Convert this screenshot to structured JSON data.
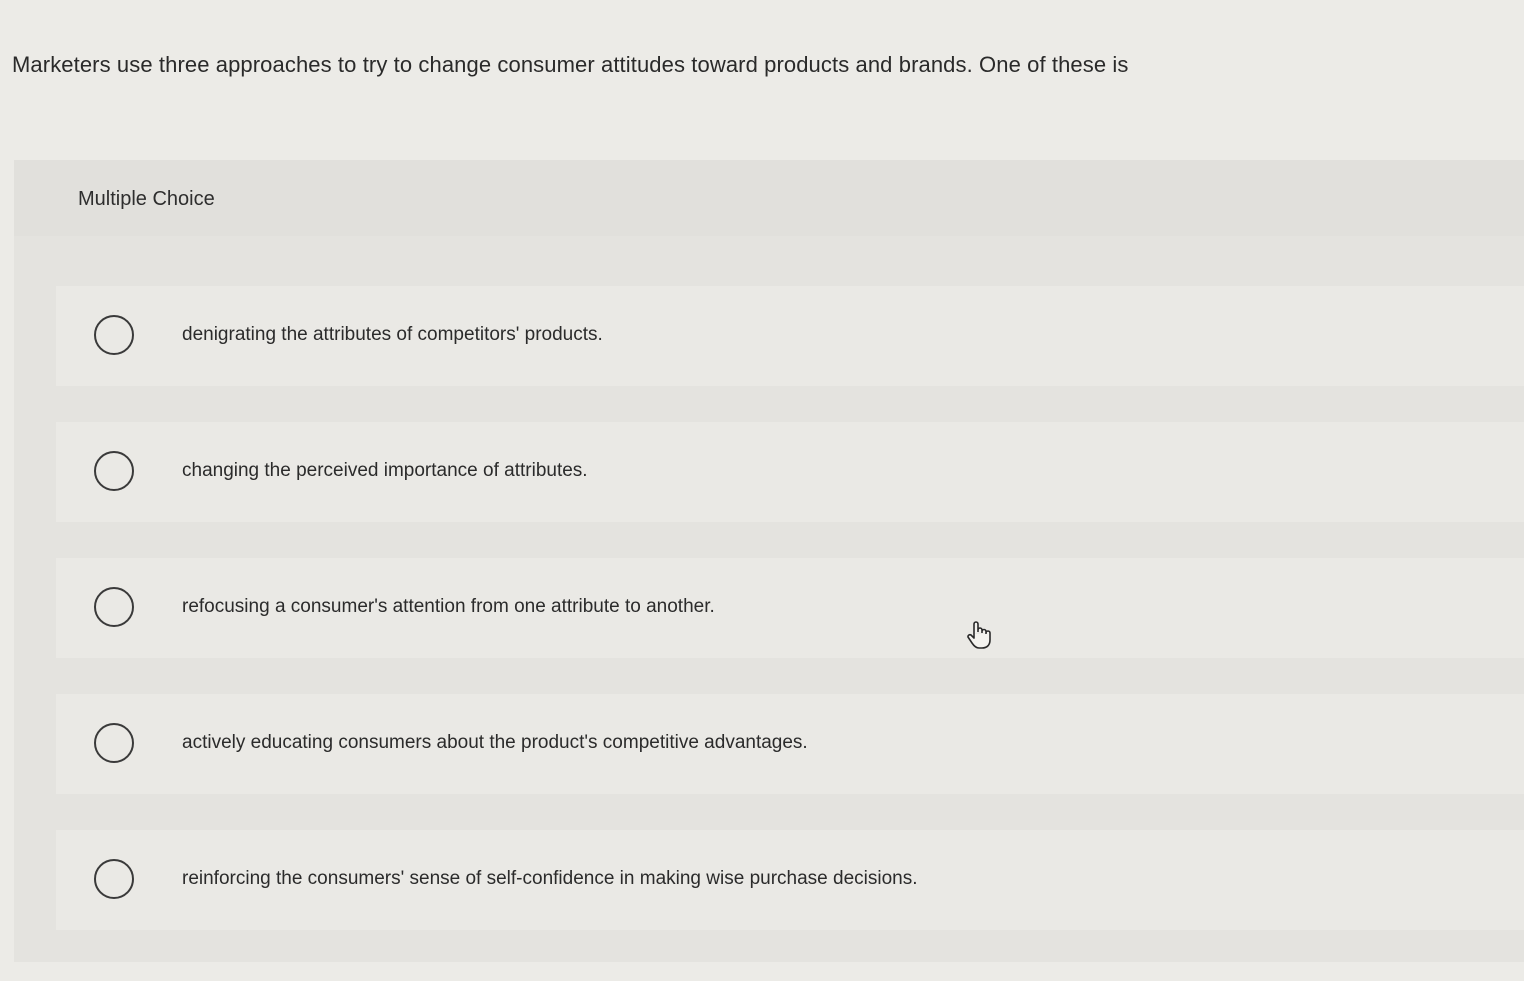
{
  "question": {
    "text": "Marketers use three approaches to try to change consumer attitudes toward products and brands. One of these is"
  },
  "multiple_choice": {
    "title": "Multiple Choice",
    "options": [
      {
        "label": "denigrating the attributes of competitors' products.",
        "selected": false
      },
      {
        "label": "changing the perceived importance of attributes.",
        "selected": false
      },
      {
        "label": "refocusing a consumer's attention from one attribute to another.",
        "selected": false
      },
      {
        "label": "actively educating consumers about the product's competitive advantages.",
        "selected": false
      },
      {
        "label": "reinforcing the consumers' sense of self-confidence in making wise purchase decisions.",
        "selected": false
      }
    ]
  },
  "cursor": {
    "icon": "hand-pointer-icon"
  }
}
